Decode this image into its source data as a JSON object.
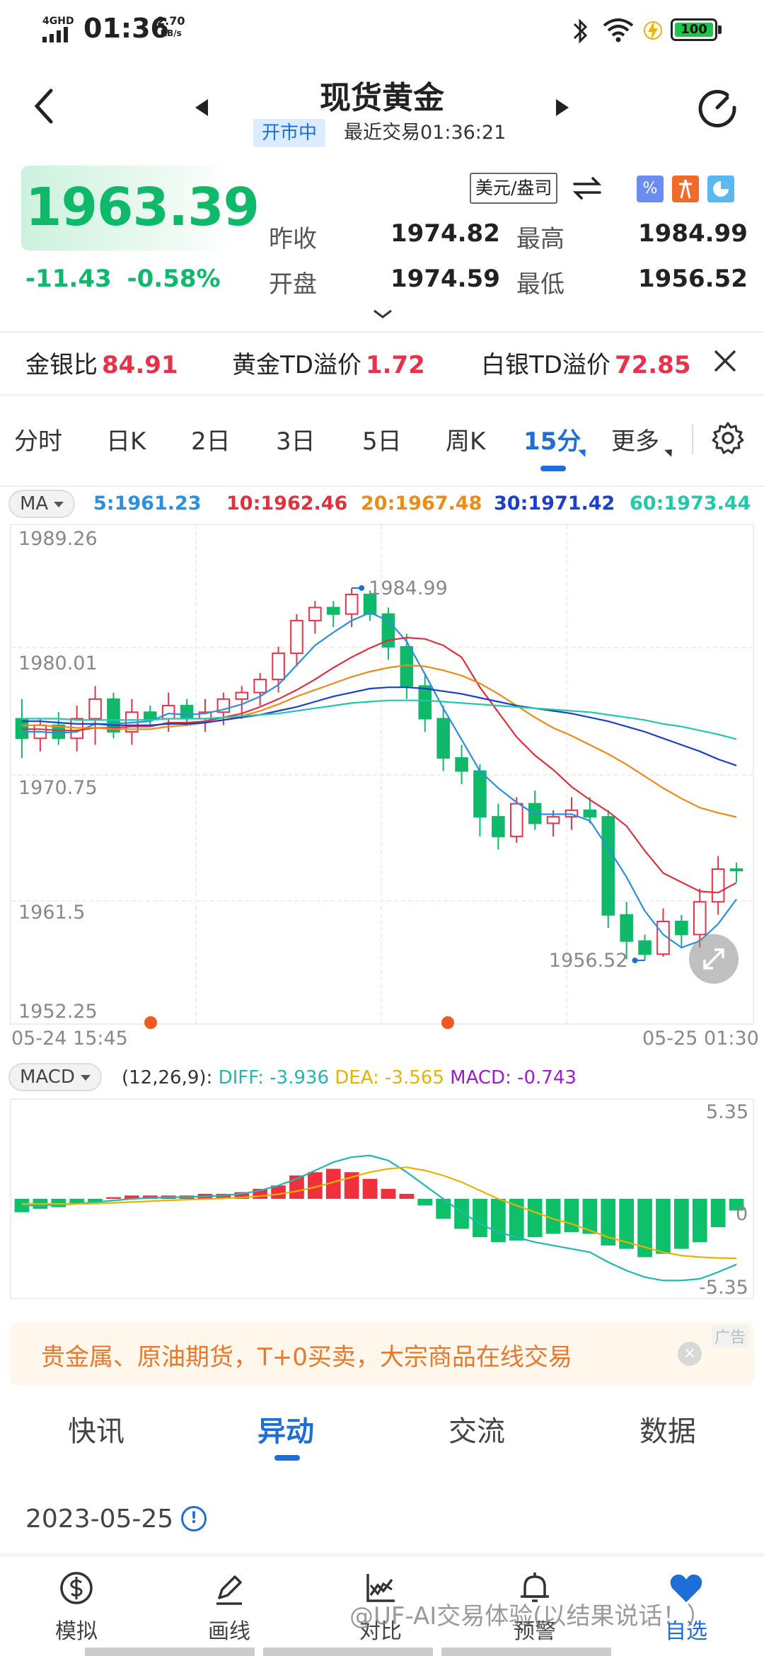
{
  "status_bar": {
    "network": "4GHD",
    "time": "01:36",
    "speed_value": "2.70",
    "speed_unit": "KB/s",
    "battery": "100"
  },
  "header": {
    "title": "现货黄金",
    "market_status": "开市中",
    "last_trade": "最近交易01:36:21"
  },
  "quote": {
    "price": "1963.39",
    "change": "-11.43",
    "change_pct": "-0.58%",
    "unit": "美元/盎司",
    "prev_close_label": "昨收",
    "prev_close": "1974.82",
    "open_label": "开盘",
    "open": "1974.59",
    "high_label": "最高",
    "high": "1984.99",
    "low_label": "最低",
    "low": "1956.52"
  },
  "ratios": [
    {
      "label": "金银比",
      "value": "84.91"
    },
    {
      "label": "黄金TD溢价",
      "value": "1.72"
    },
    {
      "label": "白银TD溢价",
      "value": "72.85"
    }
  ],
  "period_tabs": [
    "分时",
    "日K",
    "2日",
    "3日",
    "5日",
    "周K",
    "15分",
    "更多"
  ],
  "active_period": "15分",
  "ma": {
    "selector": "MA",
    "values": [
      {
        "text": "5:1961.23",
        "color": "#2a8fe0"
      },
      {
        "text": "10:1962.46",
        "color": "#e0313e"
      },
      {
        "text": "20:1967.48",
        "color": "#ef8a14"
      },
      {
        "text": "30:1971.42",
        "color": "#1a3fcf"
      },
      {
        "text": "60:1973.44",
        "color": "#20c9a8"
      }
    ]
  },
  "kchart": {
    "y_labels": [
      "1989.26",
      "1980.01",
      "1970.75",
      "1961.5",
      "1952.25"
    ],
    "x_start": "05-24 15:45",
    "x_end": "05-25 01:30",
    "high_label": "1984.99",
    "low_label": "1956.52",
    "ylim": [
      1952.25,
      1989.26
    ],
    "candles": [
      [
        1975.0,
        1976.5,
        1972.0,
        1973.5
      ],
      [
        1973.5,
        1975.0,
        1972.5,
        1974.5
      ],
      [
        1974.5,
        1975.5,
        1973.0,
        1973.5
      ],
      [
        1973.5,
        1976.0,
        1972.5,
        1975.0
      ],
      [
        1975.0,
        1977.5,
        1973.0,
        1976.5
      ],
      [
        1976.5,
        1977.0,
        1973.5,
        1974.0
      ],
      [
        1974.0,
        1976.5,
        1973.0,
        1975.5
      ],
      [
        1975.5,
        1976.0,
        1974.5,
        1975.0
      ],
      [
        1975.0,
        1977.0,
        1974.0,
        1976.0
      ],
      [
        1976.0,
        1976.5,
        1974.5,
        1975.0
      ],
      [
        1975.0,
        1976.5,
        1974.0,
        1975.5
      ],
      [
        1975.5,
        1977.0,
        1974.5,
        1976.5
      ],
      [
        1976.5,
        1977.5,
        1975.0,
        1977.0
      ],
      [
        1977.0,
        1978.5,
        1976.0,
        1978.0
      ],
      [
        1978.0,
        1980.5,
        1977.0,
        1980.0
      ],
      [
        1980.0,
        1983.0,
        1979.0,
        1982.5
      ],
      [
        1982.5,
        1984.0,
        1981.5,
        1983.5
      ],
      [
        1983.5,
        1984.0,
        1982.0,
        1983.0
      ],
      [
        1983.0,
        1984.99,
        1982.0,
        1984.5
      ],
      [
        1984.5,
        1984.8,
        1982.5,
        1983.0
      ],
      [
        1983.0,
        1983.5,
        1979.5,
        1980.5
      ],
      [
        1980.5,
        1981.5,
        1976.5,
        1977.5
      ],
      [
        1977.5,
        1978.5,
        1974.0,
        1975.0
      ],
      [
        1975.0,
        1976.0,
        1971.0,
        1972.0
      ],
      [
        1972.0,
        1973.0,
        1970.0,
        1971.0
      ],
      [
        1971.0,
        1971.5,
        1966.0,
        1967.5
      ],
      [
        1967.5,
        1968.5,
        1965.0,
        1966.0
      ],
      [
        1966.0,
        1969.0,
        1965.5,
        1968.5
      ],
      [
        1968.5,
        1969.5,
        1966.5,
        1967.0
      ],
      [
        1967.0,
        1968.0,
        1966.0,
        1967.5
      ],
      [
        1967.5,
        1969.0,
        1966.5,
        1968.0
      ],
      [
        1968.0,
        1969.0,
        1967.0,
        1967.5
      ],
      [
        1967.5,
        1968.0,
        1959.0,
        1960.0
      ],
      [
        1960.0,
        1961.0,
        1956.6,
        1958.0
      ],
      [
        1958.0,
        1958.5,
        1956.52,
        1957.0
      ],
      [
        1957.0,
        1960.5,
        1956.8,
        1959.5
      ],
      [
        1959.5,
        1960.0,
        1957.5,
        1958.5
      ],
      [
        1958.5,
        1962.0,
        1957.5,
        1961.0
      ],
      [
        1961.0,
        1964.5,
        1960.0,
        1963.5
      ],
      [
        1963.5,
        1964.0,
        1962.5,
        1963.39
      ]
    ],
    "ma_series": [
      {
        "name": "MA5",
        "color": "#2a8fe0",
        "values": [
          1974.0,
          1974.0,
          1973.9,
          1974.0,
          1974.6,
          1974.6,
          1974.7,
          1974.8,
          1975.4,
          1975.3,
          1975.4,
          1975.7,
          1976.1,
          1976.7,
          1977.6,
          1979.1,
          1980.6,
          1981.6,
          1982.5,
          1983.1,
          1982.5,
          1980.9,
          1978.4,
          1975.8,
          1973.4,
          1971.0,
          1969.7,
          1968.6,
          1967.7,
          1967.7,
          1967.7,
          1967.2,
          1965.1,
          1962.9,
          1960.3,
          1958.5,
          1957.5,
          1958.0,
          1959.3,
          1961.2
        ]
      },
      {
        "name": "MA10",
        "color": "#e0313e",
        "values": [
          1974.2,
          1974.2,
          1974.1,
          1974.1,
          1974.3,
          1974.3,
          1974.4,
          1974.4,
          1974.7,
          1974.7,
          1974.8,
          1975.1,
          1975.4,
          1975.9,
          1976.5,
          1977.2,
          1978.0,
          1978.9,
          1979.7,
          1980.4,
          1981.0,
          1981.2,
          1981.1,
          1980.6,
          1979.7,
          1977.4,
          1975.5,
          1973.6,
          1972.2,
          1971.1,
          1969.8,
          1968.8,
          1967.9,
          1966.8,
          1964.9,
          1963.2,
          1962.5,
          1961.8,
          1961.7,
          1962.46
        ]
      },
      {
        "name": "MA20",
        "color": "#ef8a14",
        "values": [
          1974.5,
          1974.5,
          1974.4,
          1974.3,
          1974.3,
          1974.2,
          1974.2,
          1974.2,
          1974.4,
          1974.5,
          1974.7,
          1974.9,
          1975.2,
          1975.6,
          1976.1,
          1976.7,
          1977.2,
          1977.7,
          1978.2,
          1978.6,
          1978.9,
          1979.1,
          1979.0,
          1978.7,
          1978.3,
          1977.7,
          1976.9,
          1976.0,
          1975.1,
          1974.3,
          1973.7,
          1973.0,
          1972.3,
          1971.5,
          1970.6,
          1969.7,
          1968.9,
          1968.2,
          1967.8,
          1967.48
        ]
      },
      {
        "name": "MA30",
        "color": "#1a3fcf",
        "values": [
          1974.8,
          1974.8,
          1974.7,
          1974.6,
          1974.6,
          1974.5,
          1974.5,
          1974.5,
          1974.6,
          1974.6,
          1974.7,
          1974.9,
          1975.1,
          1975.3,
          1975.6,
          1975.9,
          1976.3,
          1976.7,
          1977.0,
          1977.3,
          1977.4,
          1977.4,
          1977.3,
          1977.1,
          1976.9,
          1976.6,
          1976.3,
          1976.0,
          1975.8,
          1975.6,
          1975.4,
          1975.1,
          1974.8,
          1974.4,
          1974.0,
          1973.5,
          1973.0,
          1972.5,
          1971.9,
          1971.42
        ]
      },
      {
        "name": "MA60",
        "color": "#20c9a8",
        "values": [
          1975.0,
          1975.0,
          1975.0,
          1974.9,
          1974.9,
          1974.9,
          1974.9,
          1974.9,
          1975.0,
          1975.0,
          1975.0,
          1975.1,
          1975.2,
          1975.3,
          1975.4,
          1975.6,
          1975.8,
          1976.0,
          1976.2,
          1976.3,
          1976.4,
          1976.4,
          1976.4,
          1976.3,
          1976.2,
          1976.1,
          1976.0,
          1975.9,
          1975.8,
          1975.7,
          1975.6,
          1975.5,
          1975.3,
          1975.1,
          1974.9,
          1974.6,
          1974.4,
          1974.1,
          1973.8,
          1973.44
        ]
      }
    ]
  },
  "macd": {
    "selector": "MACD",
    "params": "(12,26,9):",
    "diff_text": "DIFF: -3.936",
    "dea_text": "DEA: -3.565",
    "macd_text": "MACD: -0.743",
    "diff_color": "#20b8b0",
    "dea_color": "#e6b400",
    "macd_color": "#9a1fc9",
    "y_max_label": "5.35",
    "y_zero_label": "0",
    "y_min_label": "-5.35",
    "ylim": [
      -5.35,
      5.35
    ],
    "bars": [
      -0.8,
      -0.6,
      -0.5,
      -0.3,
      -0.2,
      0.1,
      0.2,
      0.2,
      0.2,
      0.2,
      0.3,
      0.3,
      0.4,
      0.6,
      0.8,
      1.4,
      1.6,
      1.8,
      1.6,
      1.2,
      0.6,
      0.3,
      -0.4,
      -1.2,
      -1.8,
      -2.3,
      -2.6,
      -2.5,
      -2.3,
      -2.1,
      -2.0,
      -2.1,
      -2.8,
      -3.0,
      -3.5,
      -3.3,
      -3.0,
      -2.6,
      -1.7,
      -0.7
    ],
    "diff": [
      -0.4,
      -0.4,
      -0.35,
      -0.3,
      -0.2,
      -0.1,
      0.0,
      0.05,
      0.1,
      0.1,
      0.15,
      0.2,
      0.3,
      0.5,
      0.8,
      1.2,
      1.7,
      2.2,
      2.5,
      2.6,
      2.3,
      1.6,
      0.8,
      0.0,
      -0.8,
      -1.5,
      -2.0,
      -2.3,
      -2.6,
      -2.8,
      -3.0,
      -3.2,
      -3.8,
      -4.3,
      -4.7,
      -4.9,
      -4.9,
      -4.8,
      -4.4,
      -3.936
    ],
    "dea": [
      -0.3,
      -0.3,
      -0.3,
      -0.3,
      -0.28,
      -0.24,
      -0.19,
      -0.14,
      -0.09,
      -0.05,
      -0.01,
      0.03,
      0.08,
      0.16,
      0.28,
      0.46,
      0.7,
      1.0,
      1.3,
      1.6,
      1.8,
      1.9,
      1.7,
      1.4,
      1.0,
      0.5,
      0.0,
      -0.4,
      -0.8,
      -1.2,
      -1.5,
      -1.9,
      -2.3,
      -2.6,
      -2.9,
      -3.2,
      -3.4,
      -3.5,
      -3.55,
      -3.565
    ]
  },
  "ad": {
    "text": "贵金属、原油期货，T+0买卖，大宗商品在线交易",
    "tag": "广告",
    "close": "×"
  },
  "news_tabs": [
    "快讯",
    "异动",
    "交流",
    "数据"
  ],
  "active_news_tab": "异动",
  "news_date": "2023-05-25",
  "bottom_nav": [
    {
      "label": "模拟",
      "icon": "dollar-icon"
    },
    {
      "label": "画线",
      "icon": "pen-icon"
    },
    {
      "label": "对比",
      "icon": "compare-chart-icon"
    },
    {
      "label": "预警",
      "icon": "bell-icon"
    },
    {
      "label": "自选",
      "icon": "heart-icon"
    }
  ],
  "watermark": "@UF-AI交易体验(以结果说话！）"
}
